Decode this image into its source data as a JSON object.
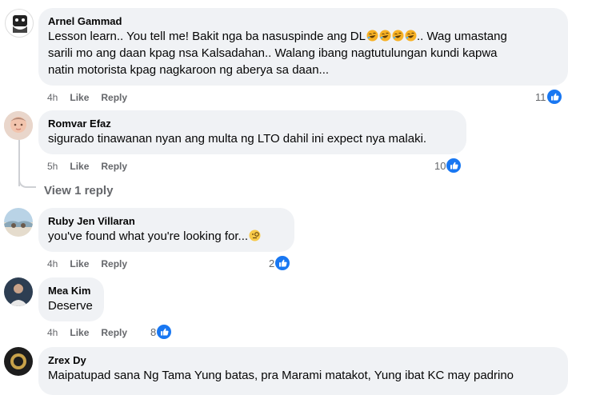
{
  "comments": [
    {
      "author": "Arnel Gammad",
      "line1": "Lesson learn.. You tell me! Bakit nga ba nasuspinde ang DL",
      "line1_suffix": "..  Wag umastang",
      "line2": "sarili mo ang daan kpag nsa Kalsadahan.. Walang ibang nagtutulungan kundi kapwa",
      "line3": "natin motorista kpag nagkaroon ng aberya sa daan...",
      "emoji": "rolling-on-floor-laughing",
      "time": "4h",
      "like": "Like",
      "reply": "Reply",
      "reactions": "11"
    },
    {
      "author": "Romvar Efaz",
      "text": "sigurado tinawanan nyan ang multa ng LTO dahil ini expect nya malaki.",
      "time": "5h",
      "like": "Like",
      "reply": "Reply",
      "reactions": "10",
      "view_replies": "View 1 reply"
    },
    {
      "author": "Ruby Jen Villaran",
      "text": "you've found what you're looking for...",
      "emoji": "monocle-face",
      "time": "4h",
      "like": "Like",
      "reply": "Reply",
      "reactions": "2"
    },
    {
      "author": "Mea Kim",
      "text": "Deserve",
      "time": "4h",
      "like": "Like",
      "reply": "Reply",
      "reactions": "8"
    },
    {
      "author": "Zrex Dy",
      "text": "Maipatupad sana Ng Tama Yung batas, pra Marami matakot, Yung ibat KC may padrino"
    }
  ],
  "colors": {
    "bubble": "#f0f2f5",
    "like_blue": "#1877f2",
    "meta_gray": "#65676b"
  }
}
